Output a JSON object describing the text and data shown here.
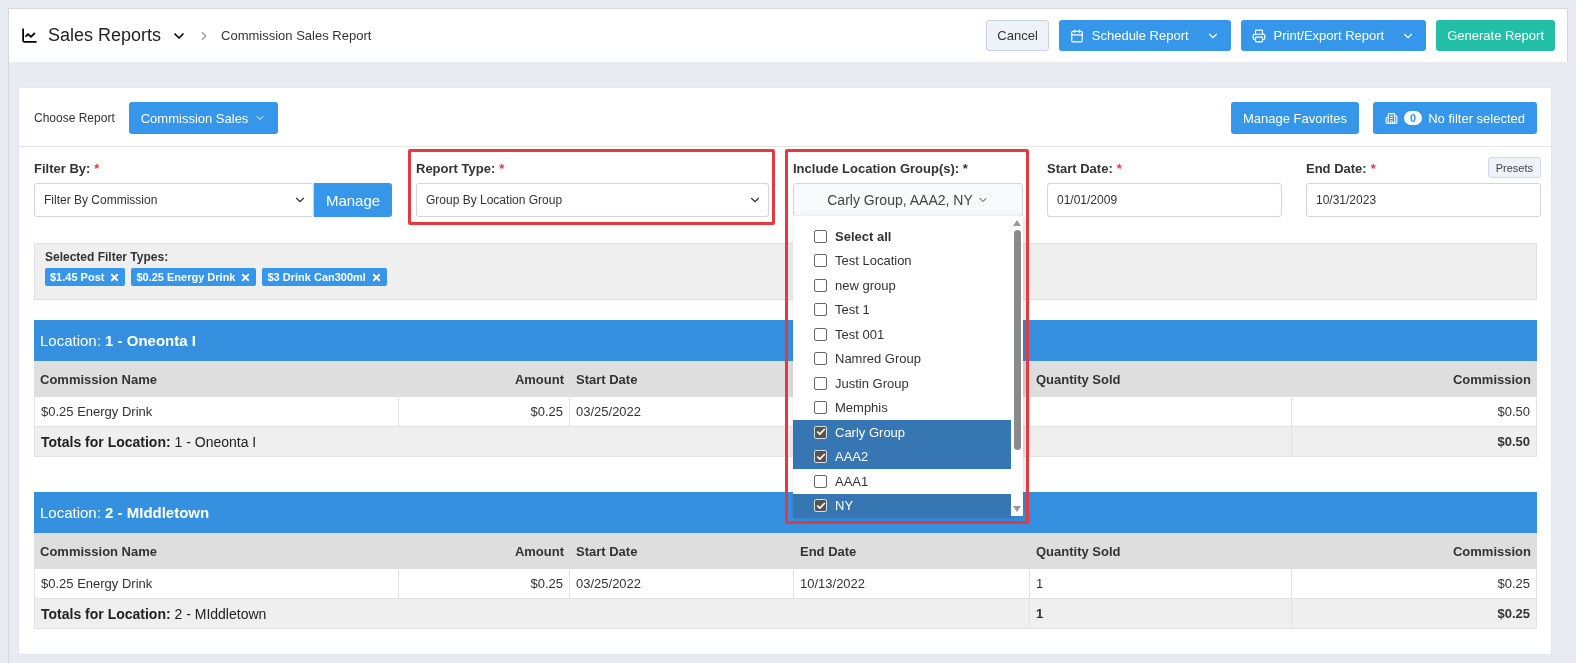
{
  "header": {
    "title": "Sales Reports",
    "breadcrumb": "Commission Sales Report",
    "buttons": [
      {
        "label": "Cancel",
        "kind": "plain"
      },
      {
        "label": "Schedule Report",
        "kind": "calendar"
      },
      {
        "label": "Print/Export Report",
        "kind": "print"
      },
      {
        "label": "Generate Report",
        "kind": "go"
      }
    ]
  },
  "choose_report": {
    "label": "Choose Report",
    "button": "Commission Sales"
  },
  "favorites_button": "Manage Favorites",
  "filter_button": {
    "count": "0",
    "label": "No filter selected"
  },
  "filters": {
    "filter_by": {
      "label": "Filter By:",
      "required_mark": "*",
      "value": "Filter By Commission",
      "button": "Manage"
    },
    "report_type": {
      "label": "Report Type:",
      "required_mark": "*",
      "value": "Group By Location Group",
      "highlighted": true
    },
    "location_groups": {
      "label": "Include Location Group(s): *",
      "value": "Carly Group, AAA2, NY",
      "highlighted": true,
      "items": [
        {
          "label": "Select all",
          "kind": "all",
          "checked": false
        },
        {
          "label": "Test Location",
          "kind": "item",
          "checked": false
        },
        {
          "label": "new group",
          "kind": "item",
          "checked": false
        },
        {
          "label": "Test 1",
          "kind": "item",
          "checked": false
        },
        {
          "label": "Test 001",
          "kind": "item",
          "checked": false
        },
        {
          "label": "Namred Group",
          "kind": "item",
          "checked": false
        },
        {
          "label": "Justin Group",
          "kind": "item",
          "checked": false
        },
        {
          "label": "Memphis",
          "kind": "item",
          "checked": false
        },
        {
          "label": "Carly Group",
          "kind": "item",
          "checked": true
        },
        {
          "label": "AAA2",
          "kind": "item",
          "checked": true
        },
        {
          "label": "AAA1",
          "kind": "item",
          "checked": false
        },
        {
          "label": "NY",
          "kind": "item",
          "checked": true
        }
      ]
    },
    "start_date": {
      "label": "Start Date:",
      "required_mark": "*",
      "value": "01/01/2009"
    },
    "end_date": {
      "label": "End Date:",
      "required_mark": "*",
      "value": "10/31/2023",
      "presets": "Presets"
    }
  },
  "selected_filter_types": {
    "label": "Selected Filter Types:",
    "tags": [
      "$1.45 Post",
      "$0.25 Energy Drink",
      "$3 Drink Can300ml"
    ]
  },
  "locations": [
    {
      "prefix": "Location:",
      "name": "1 - Oneonta I",
      "columns": [
        "Commission Name",
        "Amount",
        "Start Date",
        null,
        "Quantity Sold",
        "Commission"
      ],
      "rows": [
        [
          "$0.25 Energy Drink",
          "$0.25",
          "03/25/2022",
          null,
          null,
          "$0.50"
        ]
      ],
      "totals": {
        "label": "Totals for Location:",
        "name": "1 - Oneonta I",
        "commission": "$0.50"
      }
    },
    {
      "prefix": "Location:",
      "name": "2 - MIddletown",
      "columns": [
        "Commission Name",
        "Amount",
        "Start Date",
        "End Date",
        "Quantity Sold",
        "Commission"
      ],
      "rows": [
        [
          "$0.25 Energy Drink",
          "$0.25",
          "03/25/2022",
          "10/13/2022",
          "1",
          "$0.25"
        ]
      ],
      "totals": {
        "label": "Totals for Location:",
        "name": "2 - MIddletown",
        "quantity": "1",
        "commission": "$0.25"
      }
    }
  ]
}
